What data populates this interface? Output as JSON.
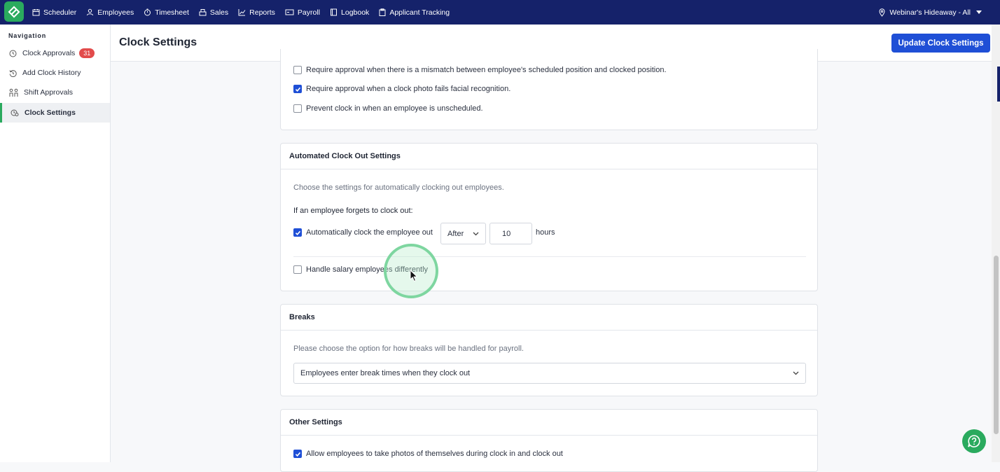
{
  "topnav": {
    "items": [
      {
        "label": "Scheduler",
        "icon": "calendar-icon"
      },
      {
        "label": "Employees",
        "icon": "person-icon"
      },
      {
        "label": "Timesheet",
        "icon": "stopwatch-icon"
      },
      {
        "label": "Sales",
        "icon": "register-icon"
      },
      {
        "label": "Reports",
        "icon": "chart-icon"
      },
      {
        "label": "Payroll",
        "icon": "payroll-icon"
      },
      {
        "label": "Logbook",
        "icon": "book-icon"
      },
      {
        "label": "Applicant Tracking",
        "icon": "clipboard-icon"
      }
    ],
    "location": "Webinar's Hideaway - All"
  },
  "sidebar": {
    "heading": "Navigation",
    "items": [
      {
        "label": "Clock Approvals",
        "badge": "31"
      },
      {
        "label": "Add Clock History"
      },
      {
        "label": "Shift Approvals"
      },
      {
        "label": "Clock Settings",
        "active": true
      }
    ]
  },
  "header": {
    "title": "Clock Settings",
    "update_button": "Update Clock Settings"
  },
  "approvals_card": {
    "rows": [
      {
        "label": "Require approval when there is a mismatch between employee's scheduled position and clocked position.",
        "checked": false
      },
      {
        "label": "Require approval when a clock photo fails facial recognition.",
        "checked": true
      },
      {
        "label": "Prevent clock in when an employee is unscheduled.",
        "checked": false
      }
    ]
  },
  "auto_clock_out": {
    "title": "Automated Clock Out Settings",
    "description": "Choose the settings for automatically clocking out employees.",
    "prompt": "If an employee forgets to clock out:",
    "auto_label": "Automatically clock the employee out",
    "auto_checked": true,
    "timing": "After",
    "hours_value": "10",
    "hours_unit": "hours",
    "salary_label": "Handle salary employees differently",
    "salary_checked": false
  },
  "breaks": {
    "title": "Breaks",
    "description": "Please choose the option for how breaks will be handled for payroll.",
    "selected": "Employees enter break times when they clock out"
  },
  "other": {
    "title": "Other Settings",
    "photos_label": "Allow employees to take photos of themselves during clock in and clock out",
    "photos_checked": true
  },
  "colors": {
    "topbar": "#15226a",
    "brand_green": "#2aaa5e",
    "primary_blue": "#1f4fd6",
    "badge_red": "#e24b4b"
  }
}
